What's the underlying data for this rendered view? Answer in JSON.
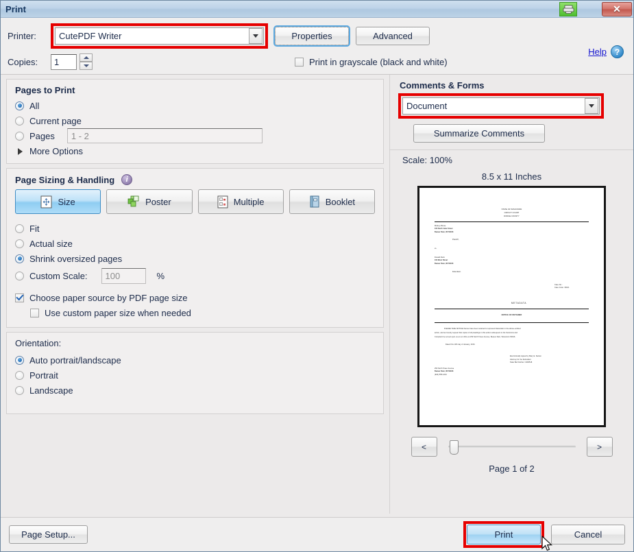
{
  "window": {
    "title": "Print",
    "printer_badge_icon": "printer-icon",
    "close_label": "✕"
  },
  "top": {
    "printer_label": "Printer:",
    "printer_value": "CutePDF Writer",
    "properties_label": "Properties",
    "advanced_label": "Advanced",
    "help_label": "Help",
    "help_icon": "question-mark-icon",
    "copies_label": "Copies:",
    "copies_value": "1",
    "grayscale_label": "Print in grayscale (black and white)",
    "grayscale_checked": false
  },
  "pages_to_print": {
    "title": "Pages to Print",
    "options": [
      {
        "label": "All",
        "selected": true
      },
      {
        "label": "Current page",
        "selected": false
      },
      {
        "label": "Pages",
        "selected": false
      }
    ],
    "pages_value": "1 - 2",
    "more_options_label": "More Options"
  },
  "page_sizing": {
    "title": "Page Sizing & Handling",
    "info_icon": "info-icon",
    "buttons": [
      {
        "label": "Size",
        "icon": "resize-arrows-icon",
        "active": true
      },
      {
        "label": "Poster",
        "icon": "poster-tiles-icon",
        "active": false
      },
      {
        "label": "Multiple",
        "icon": "multiple-pages-icon",
        "active": false
      },
      {
        "label": "Booklet",
        "icon": "booklet-icon",
        "active": false
      }
    ],
    "options": [
      {
        "label": "Fit",
        "selected": false
      },
      {
        "label": "Actual size",
        "selected": false
      },
      {
        "label": "Shrink oversized pages",
        "selected": true
      },
      {
        "label": "Custom Scale:",
        "selected": false
      }
    ],
    "custom_scale_value": "100",
    "percent_sign": "%",
    "choose_paper_source_label": "Choose paper source by PDF page size",
    "choose_paper_source_checked": true,
    "use_custom_paper_label": "Use custom paper size when needed",
    "use_custom_paper_checked": false
  },
  "orientation": {
    "title": "Orientation:",
    "options": [
      {
        "label": "Auto portrait/landscape",
        "selected": true
      },
      {
        "label": "Portrait",
        "selected": false
      },
      {
        "label": "Landscape",
        "selected": false
      }
    ]
  },
  "comments_forms": {
    "title": "Comments & Forms",
    "value": "Document",
    "summarize_label": "Summarize Comments"
  },
  "preview": {
    "scale_label": "Scale: 100%",
    "paper_size": "8.5 x 11 Inches",
    "page_count_label": "Page 1 of 2",
    "prev_label": "<",
    "next_label": ">",
    "document": {
      "court_header": [
        "STATE OF WISCONSIN",
        "CIRCUIT COURT",
        "DODGE COUNTY"
      ],
      "plaintiff_block": [
        "Mickey Mouse",
        "100 North Gate Street",
        "Beaver Dam, WI 53916"
      ],
      "plaintiff_label": "Plaintiff,",
      "vs_label": "vs.",
      "defendant_block": [
        "Donald Duck",
        "100 West Street",
        "Beaver Dam, WI 53916"
      ],
      "defendant_label": "Defendant.",
      "case_no": "Case No.:",
      "case_code": "Case Code: 30101",
      "watermark": "METADATA",
      "doc_title": "NOTICE OF RETAINER",
      "body": [
        "PLEASE TAKE NOTICE that we have been retained to represent Defendant in the above-entitled",
        "action, and we hereby request that copies of all pleadings in this action subsequent to the Summons and",
        "Complaint be served upon us at our office at 250 North Tower Avenue, Beaver Dam, Wisconsin 53916."
      ],
      "dated_line": "Dated this 10th day of January, 2016.",
      "signature_block": [
        "Electronically signed by Mary E. Nelson",
        "Attorney for the Defendant",
        "State Bar Number: 1000518"
      ],
      "firm_address": [
        "250 North Tower Avenue",
        "Beaver Dam, WI 53916",
        "(920) 555-1234"
      ]
    }
  },
  "footer": {
    "page_setup_label": "Page Setup...",
    "print_label": "Print",
    "cancel_label": "Cancel"
  },
  "colors": {
    "highlight_red": "#e60000",
    "accent_blue": "#3d8cc4",
    "title_blue": "#14355e"
  }
}
